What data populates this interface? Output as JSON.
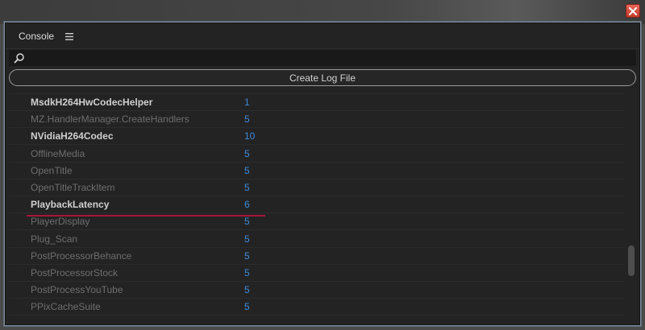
{
  "panel": {
    "title": "Console",
    "menu_icon": "hamburger-icon"
  },
  "search": {
    "icon": "search-icon",
    "value": "",
    "placeholder": ""
  },
  "toolbar": {
    "create_log_label": "Create Log File"
  },
  "rows": [
    {
      "name": "MsdkH264HwCodecHelper",
      "count": "1",
      "style": "bold"
    },
    {
      "name": "MZ.HandlerManager.CreateHandlers",
      "count": "5",
      "style": "dim"
    },
    {
      "name": "NVidiaH264Codec",
      "count": "10",
      "style": "bold"
    },
    {
      "name": "OfflineMedia",
      "count": "5",
      "style": "dim"
    },
    {
      "name": "OpenTitle",
      "count": "5",
      "style": "dim"
    },
    {
      "name": "OpenTitleTrackItem",
      "count": "5",
      "style": "dim"
    },
    {
      "name": "PlaybackLatency",
      "count": "6",
      "style": "bold"
    },
    {
      "name": "PlayerDisplay",
      "count": "5",
      "style": "dim"
    },
    {
      "name": "Plug_Scan",
      "count": "5",
      "style": "dim"
    },
    {
      "name": "PostProcessorBehance",
      "count": "5",
      "style": "dim"
    },
    {
      "name": "PostProcessorStock",
      "count": "5",
      "style": "dim"
    },
    {
      "name": "PostProcessYouTube",
      "count": "5",
      "style": "dim"
    },
    {
      "name": "PPixCacheSuite",
      "count": "5",
      "style": "dim"
    }
  ],
  "colors": {
    "count_blue": "#3f8bd8",
    "highlight_underline": "#a8163a",
    "close_red": "#d04a3a"
  }
}
